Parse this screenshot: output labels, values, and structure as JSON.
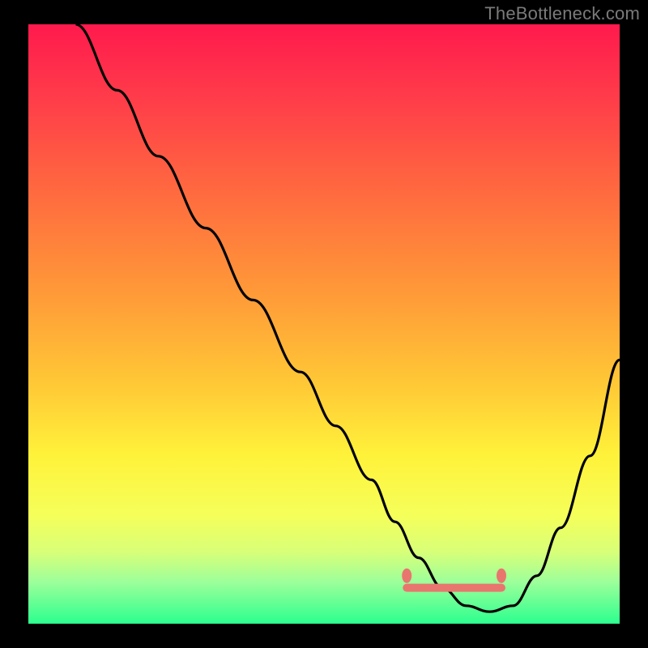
{
  "watermark": "TheBottleneck.com",
  "colors": {
    "background": "#000000",
    "curve": "#000000",
    "marker": "#e9766e",
    "gradient_stops": [
      {
        "offset": "0%",
        "color": "#ff1a4d"
      },
      {
        "offset": "12%",
        "color": "#ff3b4a"
      },
      {
        "offset": "28%",
        "color": "#ff6a3f"
      },
      {
        "offset": "45%",
        "color": "#ff9a38"
      },
      {
        "offset": "60%",
        "color": "#ffc836"
      },
      {
        "offset": "72%",
        "color": "#fff23a"
      },
      {
        "offset": "82%",
        "color": "#f5ff5a"
      },
      {
        "offset": "88%",
        "color": "#d8ff78"
      },
      {
        "offset": "93%",
        "color": "#9dff9a"
      },
      {
        "offset": "100%",
        "color": "#2cff8f"
      }
    ]
  },
  "chart_data": {
    "type": "line",
    "title": "",
    "xlabel": "",
    "ylabel": "",
    "xlim": [
      0,
      100
    ],
    "ylim": [
      0,
      100
    ],
    "x": [
      8,
      15,
      22,
      30,
      38,
      46,
      52,
      58,
      62,
      66,
      70,
      74,
      78,
      82,
      86,
      90,
      95,
      100
    ],
    "values": [
      100,
      89,
      78,
      66,
      54,
      42,
      33,
      24,
      17,
      11,
      6,
      3,
      2,
      3,
      8,
      16,
      28,
      44
    ],
    "flat_region_x": [
      64,
      80
    ],
    "flat_region_y": 6,
    "caps": [
      {
        "x": 64,
        "y": 8
      },
      {
        "x": 80,
        "y": 8
      }
    ]
  }
}
